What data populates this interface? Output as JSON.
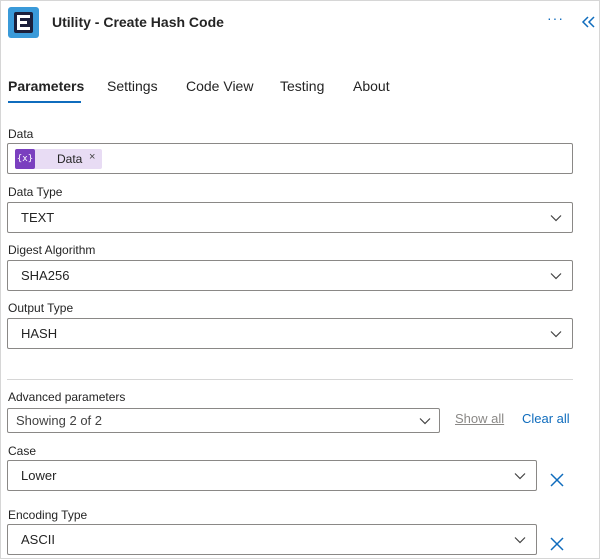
{
  "header": {
    "title": "Utility - Create Hash Code",
    "more_icon": "ellipsis-icon",
    "collapse_icon": "double-chevron-left-icon"
  },
  "tabs": [
    {
      "label": "Parameters",
      "active": true
    },
    {
      "label": "Settings",
      "active": false
    },
    {
      "label": "Code View",
      "active": false
    },
    {
      "label": "Testing",
      "active": false
    },
    {
      "label": "About",
      "active": false
    }
  ],
  "fields": {
    "data": {
      "label": "Data",
      "token_label": "Data",
      "token_icon_text": "{x}",
      "token_remove": "×"
    },
    "data_type": {
      "label": "Data Type",
      "value": "TEXT"
    },
    "digest_algorithm": {
      "label": "Digest Algorithm",
      "value": "SHA256"
    },
    "output_type": {
      "label": "Output Type",
      "value": "HASH"
    }
  },
  "advanced": {
    "label": "Advanced parameters",
    "showing": "Showing 2 of 2",
    "show_all": "Show all",
    "clear_all": "Clear all",
    "case": {
      "label": "Case",
      "value": "Lower"
    },
    "encoding_type": {
      "label": "Encoding Type",
      "value": "ASCII"
    }
  },
  "colors": {
    "accent": "#0f6cbd",
    "token_bg": "#e8dcf4",
    "token_icon": "#7a3fbf",
    "logo_bg": "#3a9ad9"
  }
}
